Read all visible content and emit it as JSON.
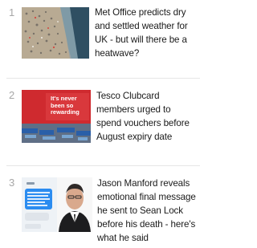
{
  "articles": [
    {
      "rank": "1",
      "headline_lines": [
        "Met Office predicts dry",
        "and settled weather for",
        "UK - but will there be a",
        "heatwave?"
      ],
      "image": "crowded-beach-photo"
    },
    {
      "rank": "2",
      "headline_lines": [
        "Tesco Clubcard",
        "members urged to",
        "spend vouchers before",
        "August expiry date"
      ],
      "image": "tesco-rewarding-sign-photo",
      "image_text": [
        "It's never",
        "been so",
        "rewarding"
      ]
    },
    {
      "rank": "3",
      "headline_lines": [
        "Jason Manford reveals",
        "emotional final message",
        "he sent to Sean Lock",
        "before his death - here's",
        "what he said"
      ],
      "image": "message-screenshot-and-portrait-photo"
    }
  ]
}
